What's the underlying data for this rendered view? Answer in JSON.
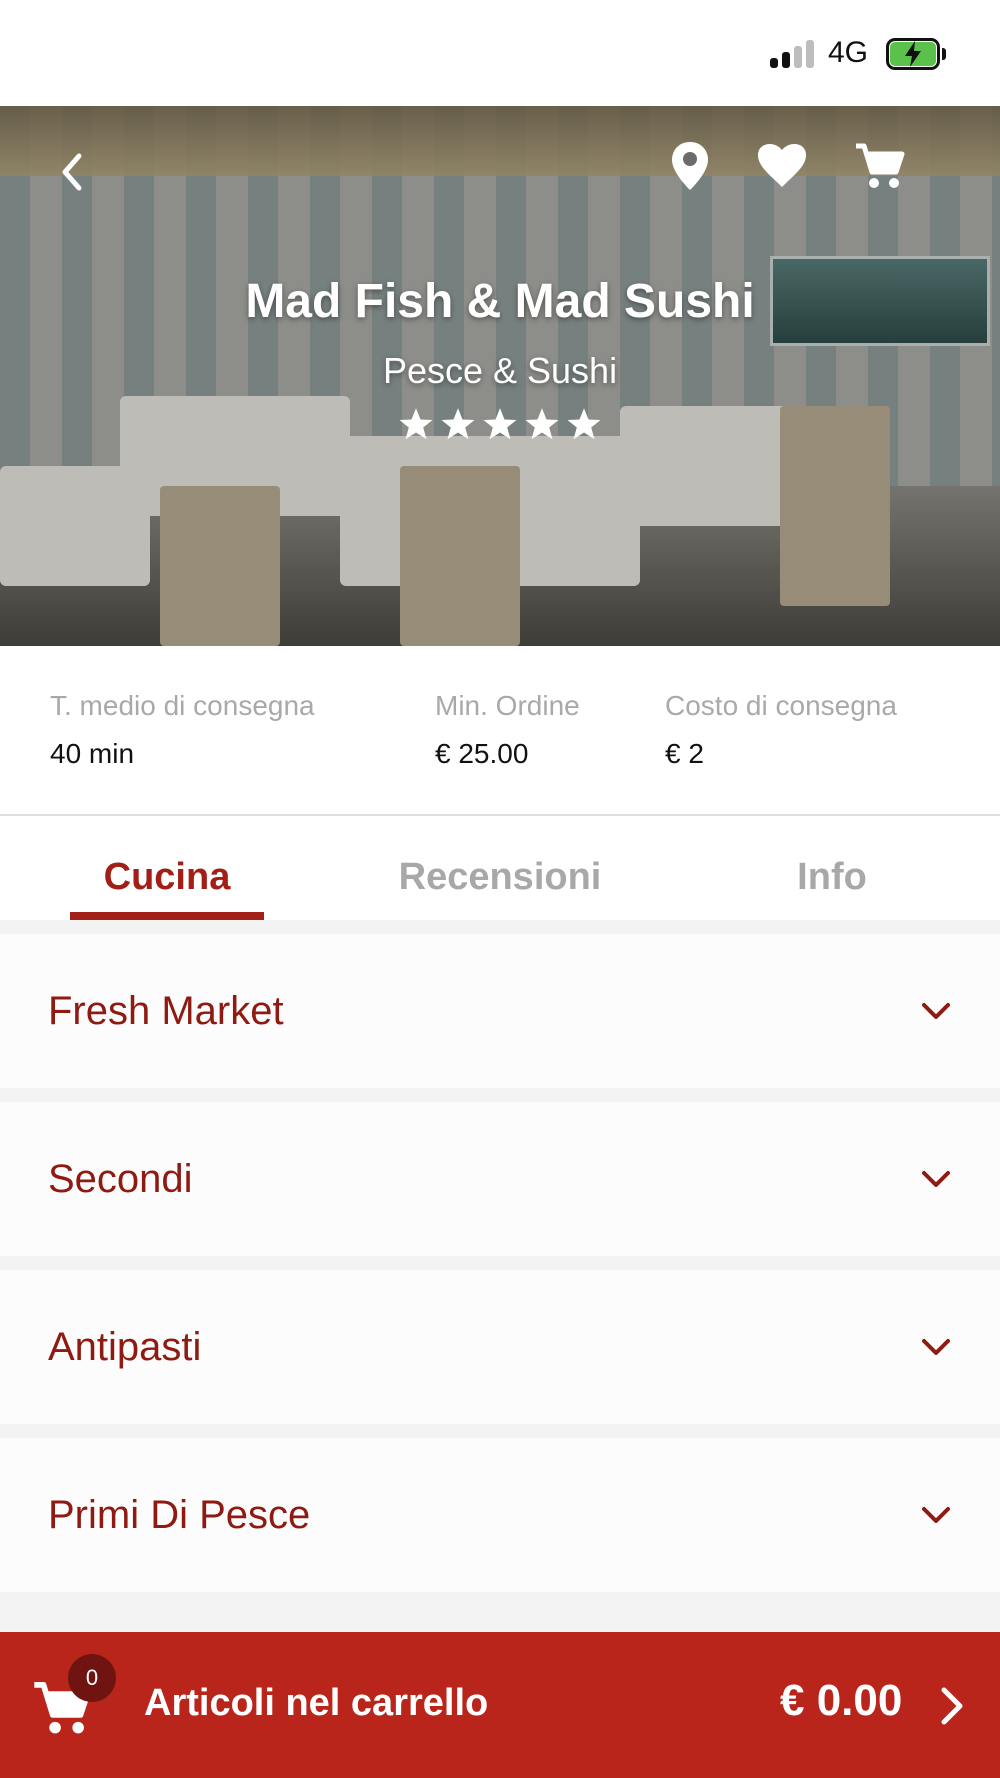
{
  "status_bar": {
    "network": "4G"
  },
  "restaurant": {
    "name": "Mad Fish & Mad Sushi",
    "category": "Pesce & Sushi",
    "rating": 5,
    "rating_max": 5
  },
  "header_icons": [
    "back-icon",
    "location-pin-icon",
    "heart-icon",
    "cart-icon"
  ],
  "info": {
    "items": [
      {
        "label": "T. medio di consegna",
        "value": "40 min"
      },
      {
        "label": "Min. Ordine",
        "value": "€ 25.00"
      },
      {
        "label": "Costo di consegna",
        "value": "€ 2"
      }
    ]
  },
  "tabs": [
    {
      "label": "Cucina",
      "active": true
    },
    {
      "label": "Recensioni",
      "active": false
    },
    {
      "label": "Info",
      "active": false
    }
  ],
  "categories": [
    {
      "label": "Fresh Market"
    },
    {
      "label": "Secondi"
    },
    {
      "label": "Antipasti"
    },
    {
      "label": "Primi Di Pesce"
    }
  ],
  "cart": {
    "count": "0",
    "label": "Articoli nel carrello",
    "total": "€ 0.00"
  },
  "colors": {
    "accent": "#a11f16",
    "cart_bar": "#b9251b",
    "inactive_tab": "#a8a8a8",
    "category_text": "#8e1a12"
  }
}
